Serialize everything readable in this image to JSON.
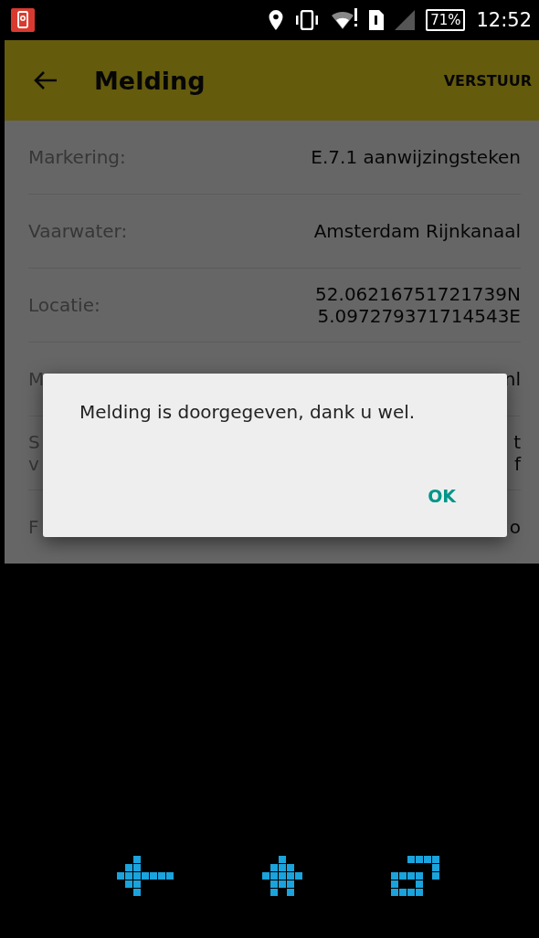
{
  "status_bar": {
    "battery": "71%",
    "time": "12:52"
  },
  "app_bar": {
    "title": "Melding",
    "action": "VERSTUUR"
  },
  "rows": [
    {
      "label": [
        "Markering:"
      ],
      "value": [
        "E.7.1 aanwijzingsteken"
      ]
    },
    {
      "label": [
        "Vaarwater:"
      ],
      "value": [
        "Amsterdam Rijnkanaal"
      ]
    },
    {
      "label": [
        "Locatie:"
      ],
      "value": [
        "52.06216751721739N",
        "5.097279371714543E"
      ]
    },
    {
      "label": [
        "M"
      ],
      "value": [
        "nl"
      ]
    },
    {
      "label": [
        "S",
        "v"
      ],
      "value": [
        "t",
        "f"
      ]
    },
    {
      "label": [
        "F"
      ],
      "value": [
        "o"
      ]
    }
  ],
  "dialog": {
    "message": "Melding is doorgegeven, dank u wel.",
    "button": "OK"
  }
}
